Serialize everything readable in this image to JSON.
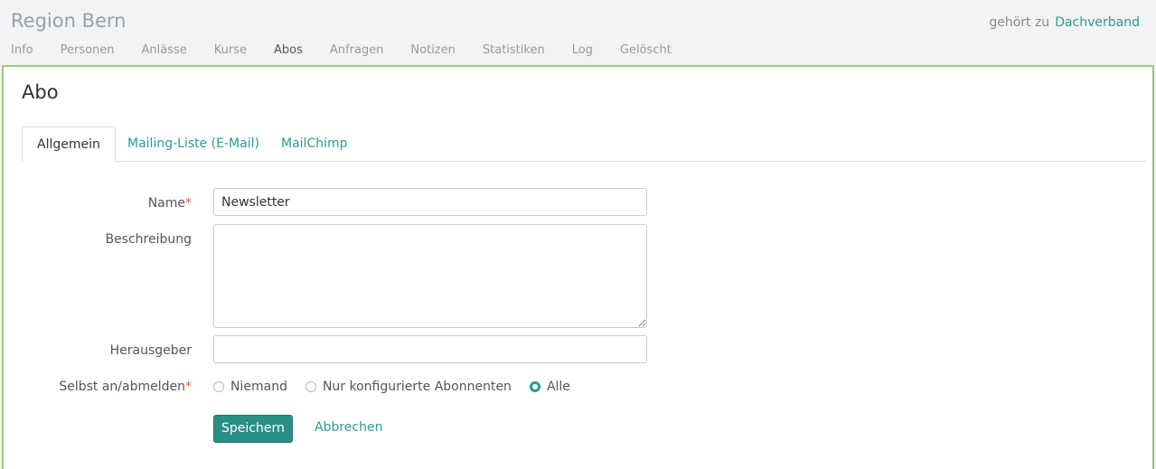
{
  "header": {
    "group_title": "Region Bern",
    "belongs_label": "gehört zu",
    "belongs_link": "Dachverband"
  },
  "nav": {
    "items": [
      {
        "label": "Info"
      },
      {
        "label": "Personen"
      },
      {
        "label": "Anlässe"
      },
      {
        "label": "Kurse"
      },
      {
        "label": "Abos"
      },
      {
        "label": "Anfragen"
      },
      {
        "label": "Notizen"
      },
      {
        "label": "Statistiken"
      },
      {
        "label": "Log"
      },
      {
        "label": "Gelöscht"
      }
    ],
    "active": "Abos"
  },
  "page": {
    "title": "Abo"
  },
  "tabs": [
    {
      "label": "Allgemein"
    },
    {
      "label": "Mailing-Liste (E-Mail)"
    },
    {
      "label": "MailChimp"
    }
  ],
  "form": {
    "name_label": "Name",
    "name_value": "Newsletter",
    "description_label": "Beschreibung",
    "description_value": "",
    "publisher_label": "Herausgeber",
    "publisher_value": "",
    "self_label": "Selbst an/abmelden",
    "required_marker": "*",
    "options": [
      {
        "label": "Niemand",
        "checked": false
      },
      {
        "label": "Nur konfigurierte Abonnenten",
        "checked": false
      },
      {
        "label": "Alle",
        "checked": true
      }
    ],
    "save_label": "Speichern",
    "cancel_label": "Abbrechen"
  },
  "colors": {
    "accent": "#2a9d8f",
    "panel_border": "#9bc77d",
    "required": "#d06a3a"
  }
}
